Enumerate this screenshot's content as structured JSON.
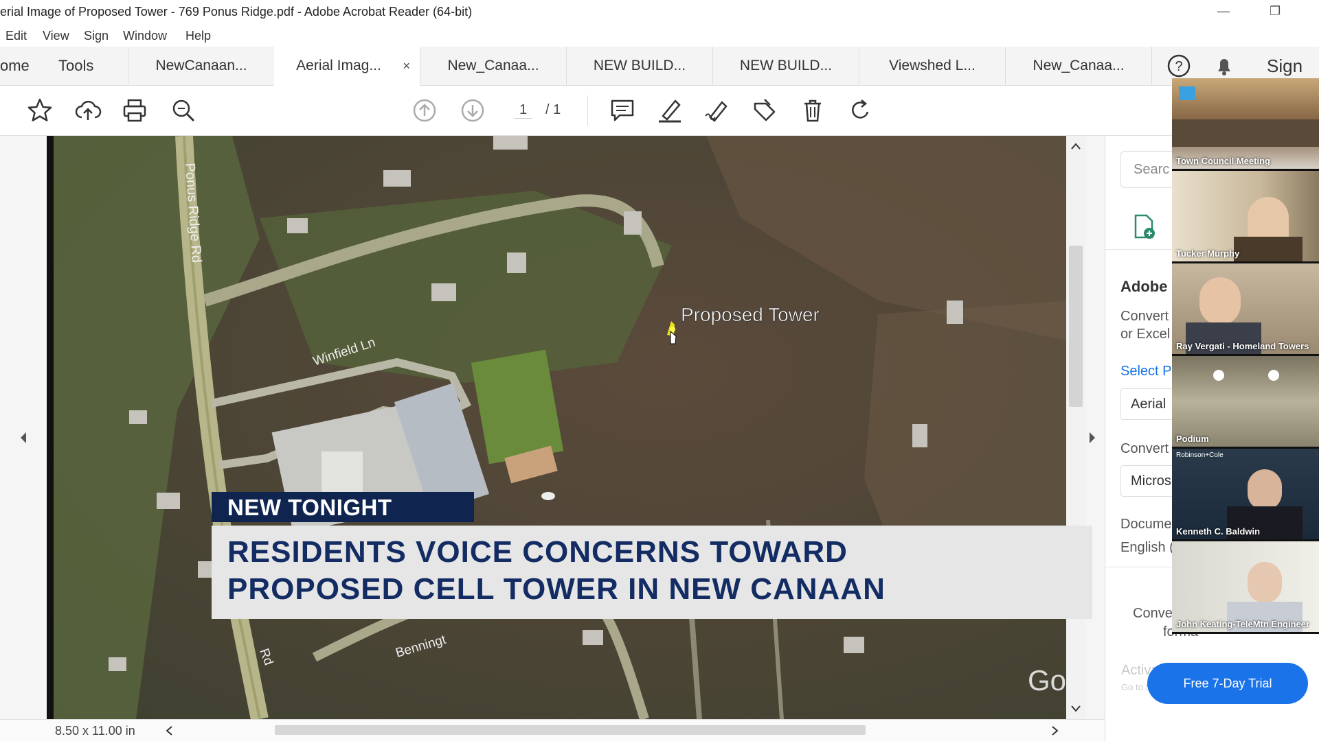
{
  "window": {
    "title": "erial Image of Proposed Tower - 769 Ponus Ridge.pdf - Adobe Acrobat Reader (64-bit)"
  },
  "menu": [
    "Edit",
    "View",
    "Sign",
    "Window",
    "Help"
  ],
  "tabs": {
    "home": "ome",
    "tools": "Tools",
    "docs": [
      {
        "label": "NewCanaan..."
      },
      {
        "label": "Aerial Imag...",
        "active": true
      },
      {
        "label": "New_Canaa..."
      },
      {
        "label": "NEW BUILD..."
      },
      {
        "label": "NEW BUILD..."
      },
      {
        "label": "Viewshed L..."
      },
      {
        "label": "New_Canaa..."
      }
    ],
    "close_glyph": "×",
    "sign_in": "Sign In"
  },
  "toolbar": {
    "page_current": "1",
    "page_total": "/ 1"
  },
  "map": {
    "labels": {
      "ponus": "Ponus Ridge Rd",
      "winfield": "Winfield Ln",
      "tower": "Proposed Tower",
      "benning": "Benningt",
      "rd": "Rd",
      "google": "Go"
    }
  },
  "status": {
    "page_size": "8.50 x 11.00 in"
  },
  "right_panel": {
    "search": "Searc",
    "adobe": "Adobe",
    "convert1": "Convert",
    "convert2": "or Excel",
    "select": "Select Pl",
    "aerial": "Aerial",
    "convert3": "Convert",
    "micros": "Micros",
    "docume": "Docume",
    "english": "English (",
    "conv2a": "Conve",
    "conv2b": "forma"
  },
  "video": {
    "tiles": [
      {
        "label": "Town Council Meeting"
      },
      {
        "label": "Tucker Murphy"
      },
      {
        "label": "Ray Vergati - Homeland Towers"
      },
      {
        "label": "Podium"
      },
      {
        "label": "Kenneth C. Baldwin",
        "sub": "Robinson+Cole"
      },
      {
        "label": "John Keating-TeleMtn Engineer"
      }
    ]
  },
  "lower_third": {
    "tag": "NEW TONIGHT",
    "line1": "RESIDENTS VOICE CONCERNS TOWARD",
    "line2": "PROPOSED CELL TOWER IN NEW CANAAN"
  },
  "overlay": {
    "trial": "Free 7-Day Trial",
    "activate": "Activate Windows",
    "activate_sub": "Go to Settings to activate Windows."
  }
}
